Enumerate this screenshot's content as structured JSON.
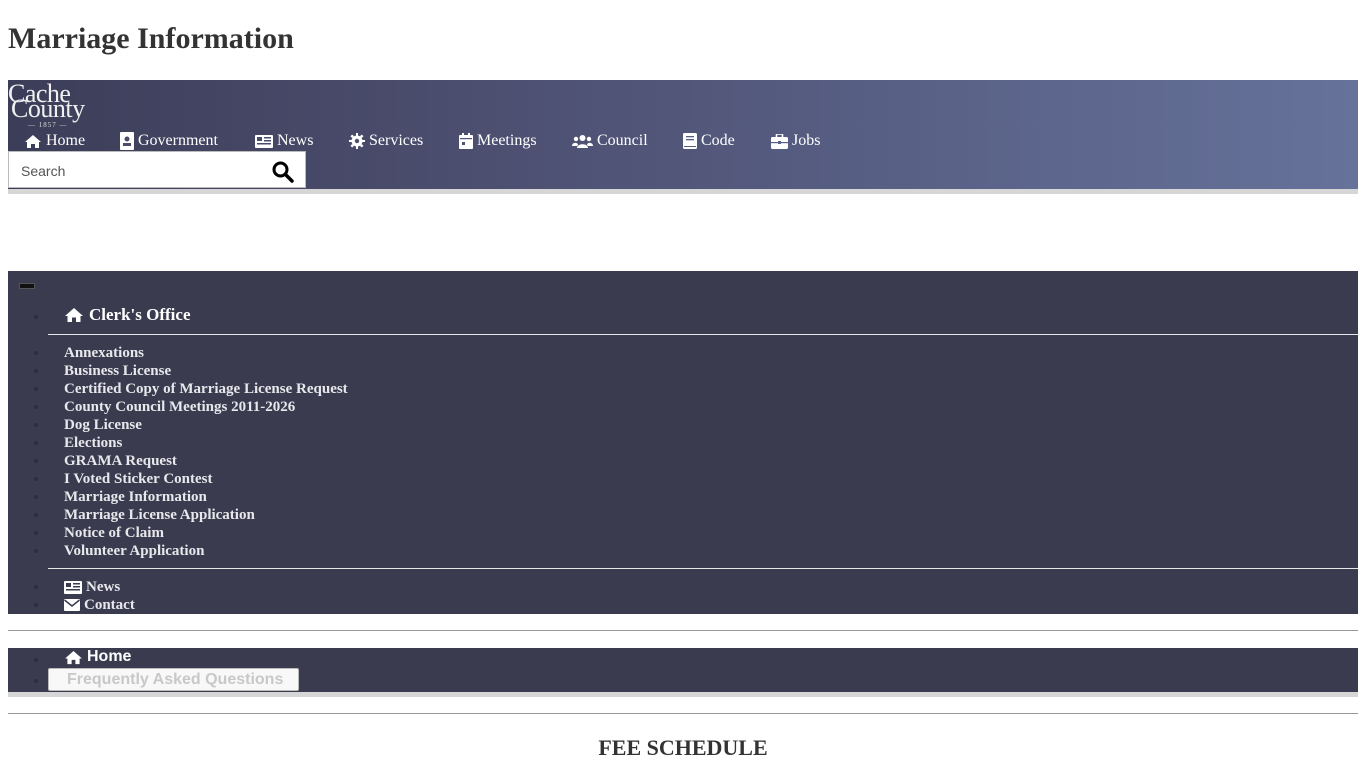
{
  "page": {
    "title": "Marriage Information"
  },
  "logo": {
    "line1": "Cache",
    "line2": "County",
    "year": "— 1857 —"
  },
  "nav": {
    "items": [
      {
        "label": "Home",
        "icon": "home-icon"
      },
      {
        "label": "Government",
        "icon": "id-card-icon"
      },
      {
        "label": "News",
        "icon": "newspaper-icon"
      },
      {
        "label": "Services",
        "icon": "gear-icon"
      },
      {
        "label": "Meetings",
        "icon": "calendar-icon"
      },
      {
        "label": "Council",
        "icon": "users-icon"
      },
      {
        "label": "Code",
        "icon": "book-icon"
      },
      {
        "label": "Jobs",
        "icon": "briefcase-icon"
      }
    ],
    "gradient_start": "#3c3d58",
    "gradient_end": "#66729a"
  },
  "search": {
    "placeholder": "Search",
    "icon": "search-icon"
  },
  "side_menu": {
    "panel_color": "#3a3b4f",
    "office_title": "Clerk's Office",
    "links": [
      "Annexations",
      "Business License",
      "Certified Copy of Marriage License Request",
      "County Council Meetings 2011-2026",
      "Dog License",
      "Elections",
      "GRAMA Request",
      "I Voted Sticker Contest",
      "Marriage Information",
      "Marriage License Application",
      "Notice of Claim",
      "Volunteer Application"
    ],
    "footer_links": [
      {
        "label": "News",
        "icon": "newspaper-icon"
      },
      {
        "label": "Contact",
        "icon": "envelope-icon"
      }
    ]
  },
  "breadcrumb": {
    "home_label": "Home",
    "faq_label": "Frequently Asked Questions"
  },
  "content": {
    "heading": "FEE SCHEDULE"
  }
}
